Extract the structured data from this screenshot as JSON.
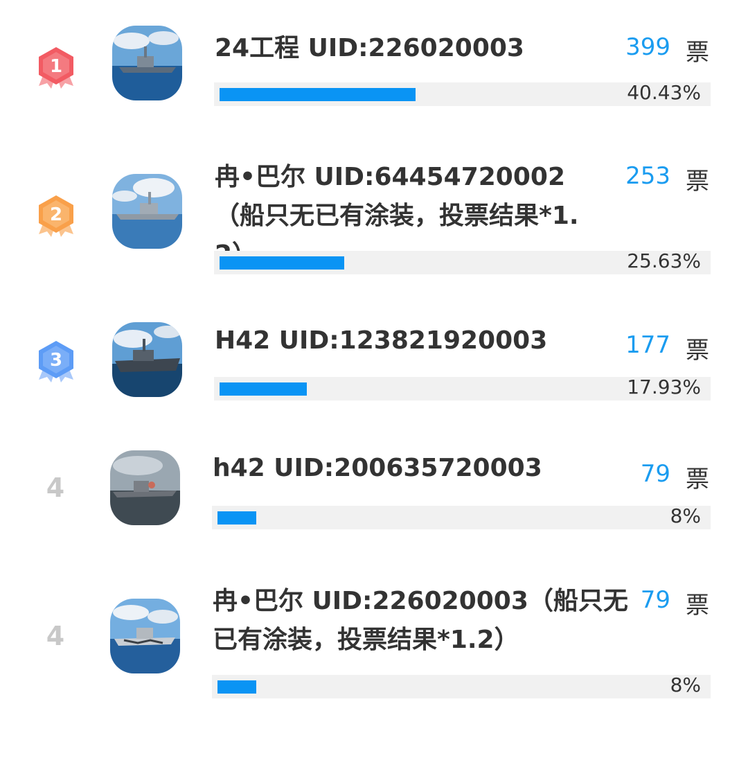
{
  "unit_label": "票",
  "entries": [
    {
      "rank": "1",
      "rank_type": "medal",
      "medal_color": "#f25b63",
      "name": "24工程 UID:226020003",
      "votes": "399",
      "percent_text": "40.43%",
      "percent_value": 40.43,
      "thumb_icon": "battleship-thumbnail-icon"
    },
    {
      "rank": "2",
      "rank_type": "medal",
      "medal_color": "#f9a04a",
      "name": "冉•巴尔 UID:64454720002（船只无已有涂装，投票结果*1.2）",
      "votes": "253",
      "percent_text": "25.63%",
      "percent_value": 25.63,
      "thumb_icon": "battleship-thumbnail-icon"
    },
    {
      "rank": "3",
      "rank_type": "medal",
      "medal_color": "#5d9cf6",
      "name": "H42 UID:123821920003",
      "votes": "177",
      "percent_text": "17.93%",
      "percent_value": 17.93,
      "thumb_icon": "battleship-thumbnail-icon"
    },
    {
      "rank": "4",
      "rank_type": "number",
      "name": "h42 UID:200635720003",
      "votes": "79",
      "percent_text": "8%",
      "percent_value": 8,
      "thumb_icon": "battleship-thumbnail-icon"
    },
    {
      "rank": "4",
      "rank_type": "number",
      "name": "冉•巴尔 UID:226020003（船只无已有涂装，投票结果*1.2）",
      "votes": "79",
      "percent_text": "8%",
      "percent_value": 8,
      "thumb_icon": "battleship-thumbnail-icon"
    }
  ],
  "colors": {
    "vote_count": "#1a9cf0",
    "bar_fill": "#0a94f4",
    "bar_track": "#f1f1f1",
    "rank_plain": "#c8c8c8"
  }
}
